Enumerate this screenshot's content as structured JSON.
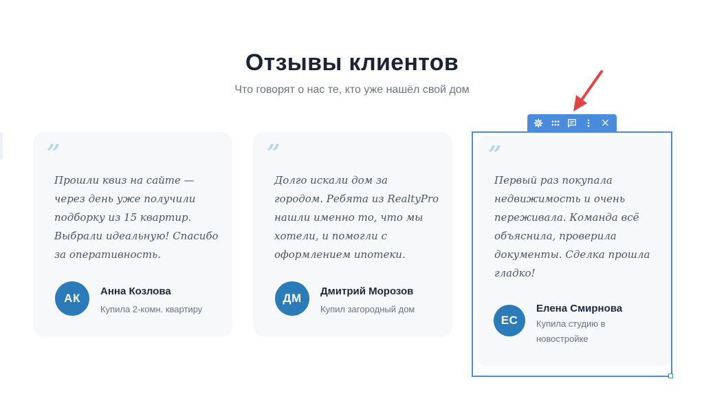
{
  "section": {
    "title": "Отзывы клиентов",
    "subtitle": "Что говорят о нас те, кто уже нашёл свой дом"
  },
  "testimonials": [
    {
      "quote_mark": "”",
      "text": "Прошли квиз на сайте — через день уже получили подборку из 15 квартир. Выбрали идеальную! Спасибо за оперативность.",
      "initials": "АК",
      "name": "Анна Козлова",
      "role": "Купила 2-комн. квартиру"
    },
    {
      "quote_mark": "”",
      "text": "Долго искали дом за городом. Ребята из RealtyPro нашли именно то, что мы хотели, и помогли с оформлением ипотеки.",
      "initials": "ДМ",
      "name": "Дмитрий Морозов",
      "role": "Купил загородный дом"
    },
    {
      "quote_mark": "”",
      "text": "Первый раз покупала недвижимость и очень переживала. Команда всё объяснила, проверила документы. Сделка прошла гладко!",
      "initials": "ЕС",
      "name": "Елена Смирнова",
      "role": "Купила студию в новостройке"
    }
  ],
  "toolbar": {
    "icons": [
      "gear-icon",
      "drag-handle-icon",
      "comment-icon",
      "more-vertical-icon",
      "close-icon"
    ]
  },
  "colors": {
    "accent": "#2b7bb9",
    "selection": "#4a8bdc",
    "card_bg": "#f6f8fa",
    "annotation_arrow": "#e04444"
  }
}
